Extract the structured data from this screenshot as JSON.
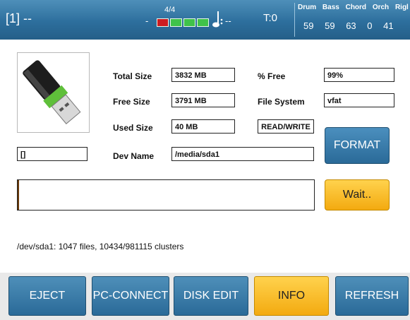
{
  "topbar": {
    "song_title": "[1] --",
    "time_sig_dash": "-",
    "time_sig": "4/4",
    "beats_total": 4,
    "beat_active": 1,
    "tempo_text": "--",
    "transpose": "T:0",
    "volume_labels": [
      "Drum",
      "Bass",
      "Chord",
      "Orch",
      "Rigl"
    ],
    "volume_values": [
      "59",
      "59",
      "63",
      "0",
      "41"
    ]
  },
  "info": {
    "total_size_label": "Total Size",
    "total_size_value": "3832 MB",
    "free_size_label": "Free Size",
    "free_size_value": "3791 MB",
    "used_size_label": "Used Size",
    "used_size_value": "40 MB",
    "percent_free_label": "% Free",
    "percent_free_value": "99%",
    "file_system_label": "File System",
    "file_system_value": "vfat",
    "access_value": "READ/WRITE",
    "dev_name_label": "Dev Name",
    "dev_name_value": "/media/sda1",
    "volume_name_value": "[]",
    "progress_fraction": 0.005,
    "stats": "/dev/sda1: 1047 files, 10434/981115 clusters"
  },
  "buttons": {
    "format": "FORMAT",
    "wait": "Wait.."
  },
  "tabs": [
    "EJECT",
    "PC-CONNECT",
    "DISK EDIT",
    "INFO",
    "REFRESH"
  ],
  "colors": {
    "accent_blue": "#2d6f9d",
    "active_yellow": "#f3aa10",
    "beat_green": "#3fc24a",
    "beat_red": "#cc1c22"
  }
}
